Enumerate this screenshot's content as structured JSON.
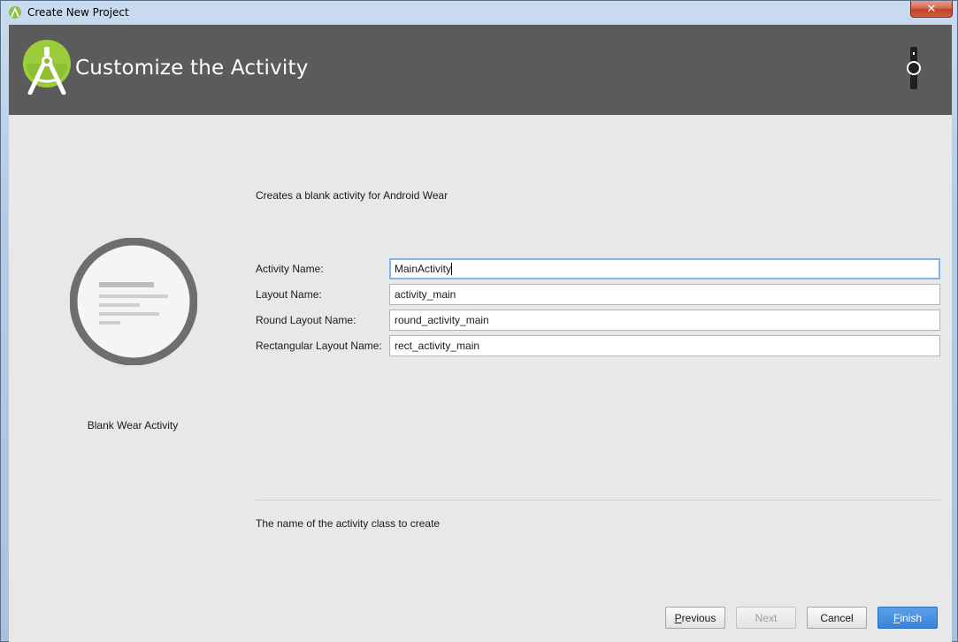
{
  "window": {
    "title": "Create New Project",
    "close_glyph": "✕"
  },
  "header": {
    "title": "Customize the Activity",
    "logo_icon": "android-studio-icon",
    "device_icon": "wear-watch-icon"
  },
  "preview": {
    "icon": "blank-wear-activity-icon",
    "label": "Blank Wear Activity"
  },
  "form": {
    "description": "Creates a blank activity for Android Wear",
    "fields": [
      {
        "label": "Activity Name:",
        "value": "MainActivity",
        "focused": true
      },
      {
        "label": "Layout Name:",
        "value": "activity_main",
        "focused": false
      },
      {
        "label": "Round Layout Name:",
        "value": "round_activity_main",
        "focused": false
      },
      {
        "label": "Rectangular Layout Name:",
        "value": "rect_activity_main",
        "focused": false
      }
    ],
    "hint": "The name of the activity class to create"
  },
  "buttons": {
    "previous": {
      "mnemonic": "P",
      "rest": "revious"
    },
    "next": "Next",
    "cancel": "Cancel",
    "finish": {
      "mnemonic": "F",
      "rest": "inish"
    }
  },
  "colors": {
    "header_bg": "#5b5b5b",
    "client_bg": "#e8e8e8",
    "android_green": "#a4c639",
    "focus_blue": "#84b4e8",
    "primary_button": "#3a83d8"
  }
}
